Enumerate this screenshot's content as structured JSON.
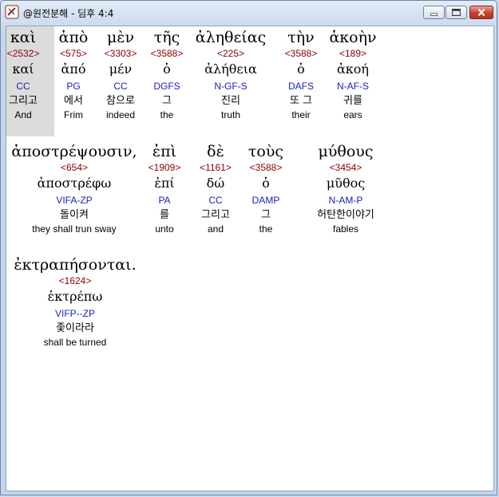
{
  "window": {
    "title": "@원전분해 - 딤후 4:4",
    "controls": [
      "minimize-icon",
      "maximize-icon",
      "close-icon"
    ]
  },
  "lines": [
    {
      "words": [
        {
          "greek": "καὶ",
          "strong": "<2532>",
          "lemma": "καί",
          "morph": "CC",
          "korean": "그리고",
          "english": "And"
        },
        {
          "greek": "ἀπὸ",
          "strong": "<575>",
          "lemma": "ἀπό",
          "morph": "PG",
          "korean": "에서",
          "english": "Frim"
        },
        {
          "greek": "μὲν",
          "strong": "<3303>",
          "lemma": "μέν",
          "morph": "CC",
          "korean": "참으로",
          "english": "indeed"
        },
        {
          "greek": "τῆς",
          "strong": "<3588>",
          "lemma": "ὁ",
          "morph": "DGFS",
          "korean": "그",
          "english": "the"
        },
        {
          "greek": "ἀληθείας",
          "strong": "<225>",
          "lemma": "ἀλήθεια",
          "morph": "N-GF-S",
          "korean": "진리",
          "english": "truth"
        },
        {
          "greek": "τὴν",
          "strong": "<3588>",
          "lemma": "ὁ",
          "morph": "DAFS",
          "korean": "또 그",
          "english": "their"
        },
        {
          "greek": "ἀκοὴν",
          "strong": "<189>",
          "lemma": "ἀκοή",
          "morph": "N-AF-S",
          "korean": "귀를",
          "english": "ears"
        }
      ]
    },
    {
      "words": [
        {
          "greek": "ἀποστρέψουσιν,",
          "strong": "<654>",
          "lemma": "ἀποστρέφω",
          "morph": "VIFA-ZP",
          "korean": "돌이켜",
          "english": "they shall trun sway"
        },
        {
          "greek": "ἐπὶ",
          "strong": "<1909>",
          "lemma": "ἐπί",
          "morph": "PA",
          "korean": "를",
          "english": "unto"
        },
        {
          "greek": "δὲ",
          "strong": "<1161>",
          "lemma": "δώ",
          "morph": "CC",
          "korean": "그리고",
          "english": "and"
        },
        {
          "greek": "τοὺς",
          "strong": "<3588>",
          "lemma": "ὁ",
          "morph": "DAMP",
          "korean": "그",
          "english": "the"
        },
        {
          "greek": "μύθους",
          "strong": "<3454>",
          "lemma": "μῦθος",
          "morph": "N-AM-P",
          "korean": "허탄한이야기",
          "english": "fables"
        }
      ]
    },
    {
      "words": [
        {
          "greek": "ἐκτραπήσονται.",
          "strong": "<1624>",
          "lemma": "ἐκτρέπω",
          "morph": "VIFP--ZP",
          "korean": "좇이라라",
          "english": "shall be turned"
        }
      ]
    }
  ]
}
